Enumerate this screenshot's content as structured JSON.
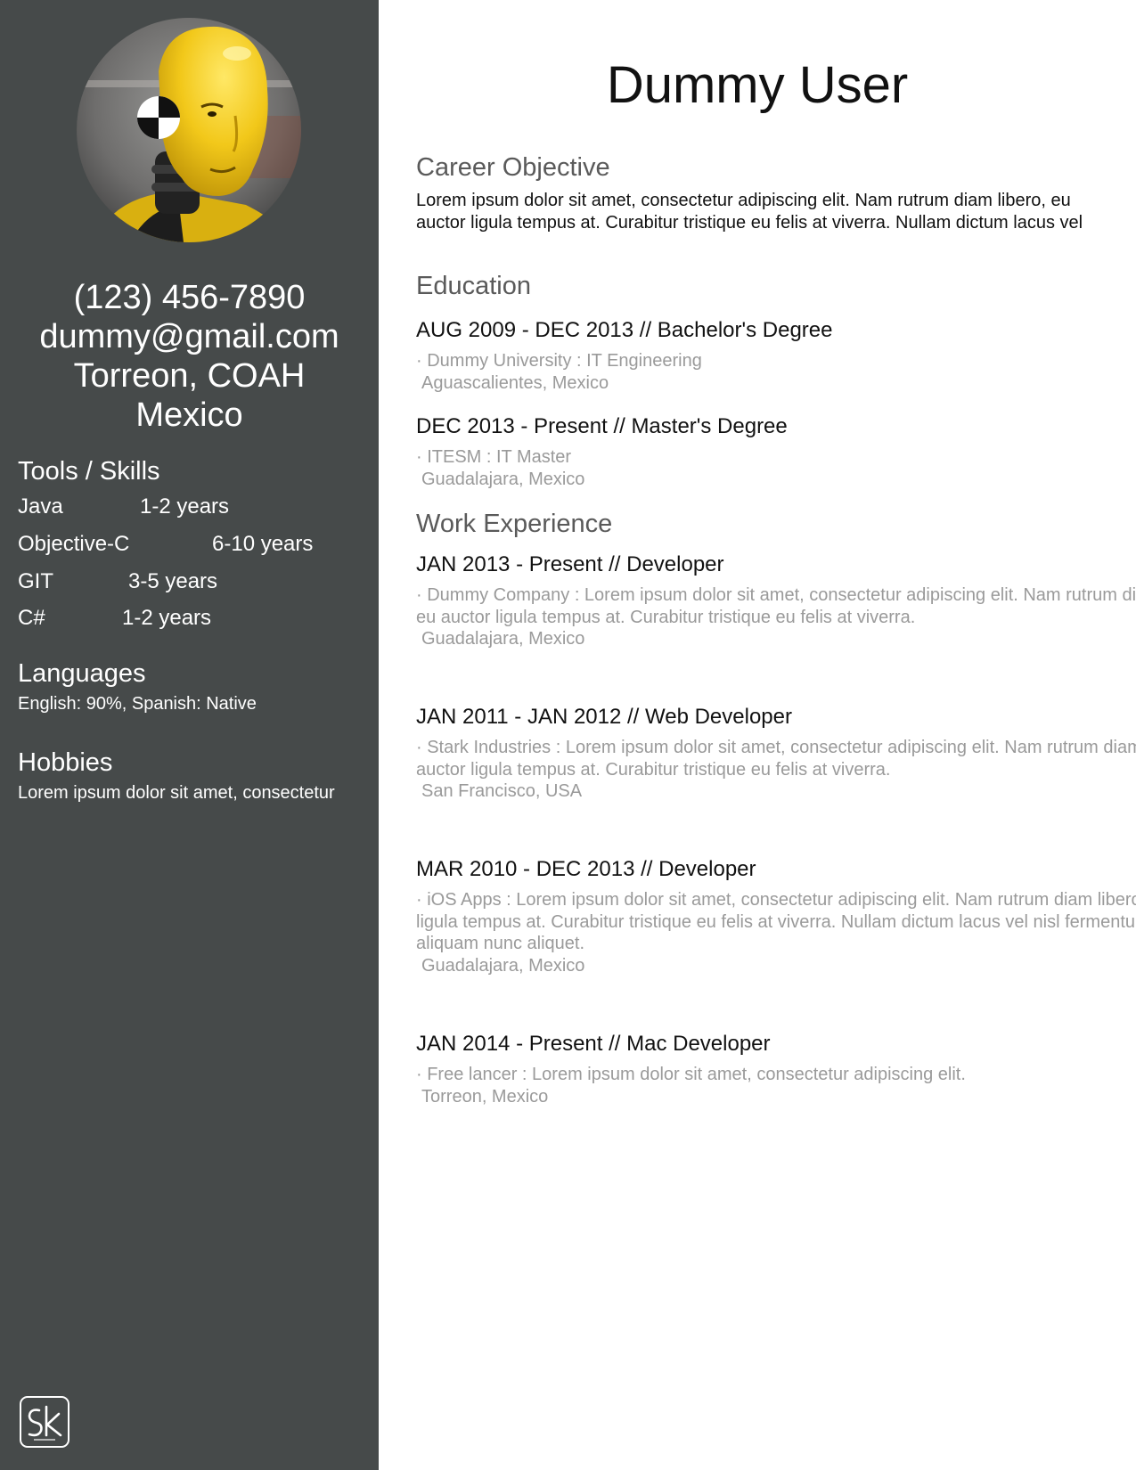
{
  "sidebar": {
    "contact": {
      "phone": "(123) 456-7890",
      "email": "dummy@gmail.com",
      "city": "Torreon, COAH",
      "country": "Mexico"
    },
    "skills_heading": "Tools / Skills",
    "skills": [
      {
        "name": "Java",
        "years": "1-2 years"
      },
      {
        "name": "Objective-C",
        "years": "6-10 years"
      },
      {
        "name": "GIT",
        "years": "3-5 years"
      },
      {
        "name": "C#",
        "years": "1-2 years"
      }
    ],
    "languages_heading": "Languages",
    "languages_text": "English: 90%, Spanish: Native",
    "hobbies_heading": "Hobbies",
    "hobbies_text": "Lorem ipsum dolor sit amet, consectetur",
    "logo_text": "SK",
    "avatar_icon": "crash-test-dummy-photo"
  },
  "main": {
    "name": "Dummy User",
    "career": {
      "heading": "Career Objective",
      "lines": [
        "Lorem ipsum dolor sit amet, consectetur adipiscing elit. Nam rutrum diam libero, eu",
        "auctor ligula tempus at. Curabitur tristique eu felis at viverra. Nullam dictum lacus vel"
      ]
    },
    "education": {
      "heading": "Education",
      "entries": [
        {
          "title": "AUG 2009 - DEC 2013 // Bachelor's Degree",
          "desc": [
            "· Dummy University : IT Engineering"
          ],
          "location": "Aguascalientes, Mexico"
        },
        {
          "title": "DEC 2013 - Present // Master's Degree",
          "desc": [
            "· ITESM : IT Master"
          ],
          "location": "Guadalajara, Mexico"
        }
      ]
    },
    "work": {
      "heading": "Work Experience",
      "entries": [
        {
          "title": "JAN 2013 - Present // Developer",
          "desc": [
            "· Dummy Company : Lorem ipsum dolor sit amet, consectetur adipiscing elit. Nam rutrum diam libero,",
            "eu auctor ligula tempus at. Curabitur tristique eu felis at viverra."
          ],
          "location": "Guadalajara, Mexico"
        },
        {
          "title": "JAN 2011 - JAN 2012 // Web Developer",
          "desc": [
            "· Stark Industries : Lorem ipsum dolor sit amet, consectetur adipiscing elit. Nam rutrum diam libero, eu",
            "auctor ligula tempus at. Curabitur tristique eu felis at viverra."
          ],
          "location": "San Francisco, USA"
        },
        {
          "title": "MAR 2010 - DEC 2013 // Developer",
          "desc": [
            "· iOS Apps : Lorem ipsum dolor sit amet, consectetur adipiscing elit. Nam rutrum diam libero, eu auctor",
            "ligula tempus at. Curabitur tristique eu felis at viverra. Nullam dictum lacus vel nisl fermentum, a",
            "aliquam nunc aliquet."
          ],
          "location": "Guadalajara, Mexico"
        },
        {
          "title": "JAN 2014 - Present // Mac Developer",
          "desc": [
            "· Free lancer : Lorem ipsum dolor sit amet, consectetur adipiscing elit."
          ],
          "location": "Torreon, Mexico"
        }
      ]
    }
  }
}
